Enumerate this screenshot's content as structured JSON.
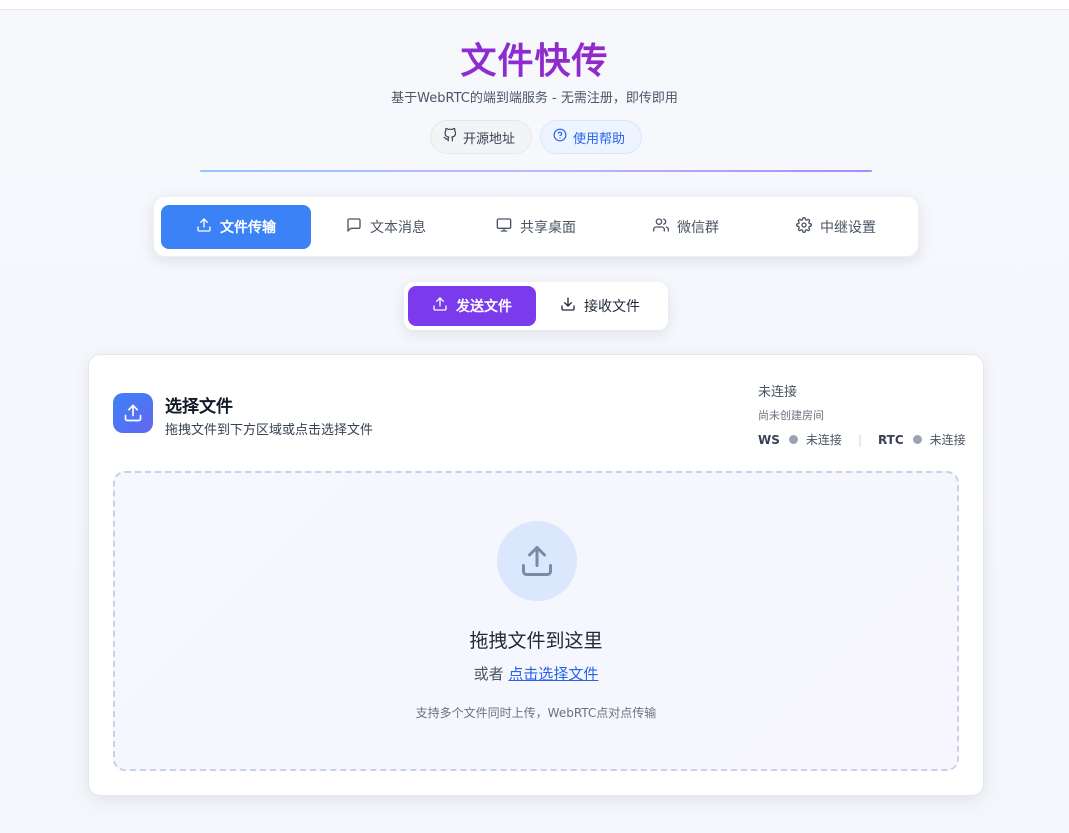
{
  "header": {
    "title": "文件快传",
    "subtitle": "基于WebRTC的端到端服务 - 无需注册，即传即用",
    "links": [
      {
        "label": "开源地址",
        "icon": "github-icon"
      },
      {
        "label": "使用帮助",
        "icon": "help-circle-icon"
      }
    ]
  },
  "tabs": [
    {
      "label": "文件传输",
      "icon": "upload-icon",
      "active": true
    },
    {
      "label": "文本消息",
      "icon": "message-icon",
      "active": false
    },
    {
      "label": "共享桌面",
      "icon": "monitor-icon",
      "active": false
    },
    {
      "label": "微信群",
      "icon": "users-icon",
      "active": false
    },
    {
      "label": "中继设置",
      "icon": "gear-icon",
      "active": false
    }
  ],
  "subtabs": [
    {
      "label": "发送文件",
      "icon": "upload-icon",
      "active": true
    },
    {
      "label": "接收文件",
      "icon": "download-icon",
      "active": false
    }
  ],
  "card": {
    "title": "选择文件",
    "subtitle": "拖拽文件到下方区域或点击选择文件",
    "status": {
      "main": "未连接",
      "room": "尚未创建房间",
      "ws_label": "WS",
      "ws_status": "未连接",
      "separator": "|",
      "rtc_label": "RTC",
      "rtc_status": "未连接"
    }
  },
  "dropzone": {
    "title": "拖拽文件到这里",
    "or_text": "或者",
    "pick_link": "点击选择文件",
    "hint": "支持多个文件同时上传，WebRTC点对点传输"
  },
  "colors": {
    "primary": "#3b82f6",
    "accent": "#7c3aed",
    "status_dot": "#9ca3af"
  }
}
